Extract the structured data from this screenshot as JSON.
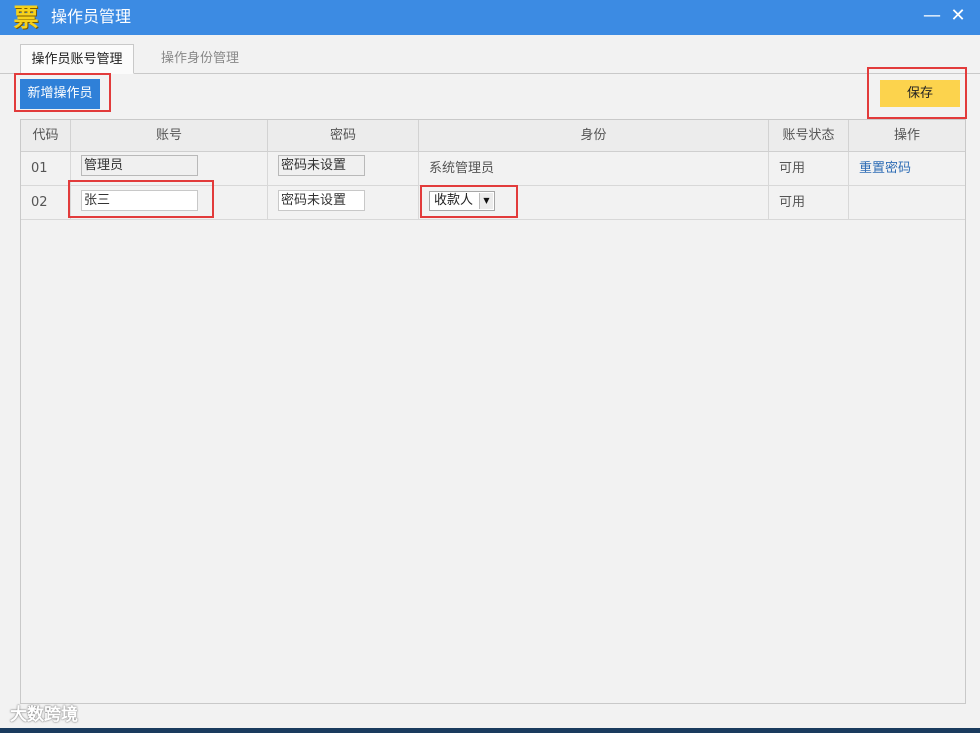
{
  "window": {
    "title": "操作员管理",
    "app_icon_char": "票",
    "minimize_glyph": "—",
    "close_glyph": "✕"
  },
  "tabs": [
    {
      "label": "操作员账号管理",
      "active": true
    },
    {
      "label": "操作身份管理",
      "active": false
    }
  ],
  "toolbar": {
    "add_label": "新增操作员",
    "save_label": "保存"
  },
  "table": {
    "headers": [
      "代码",
      "账号",
      "密码",
      "身份",
      "账号状态",
      "操作"
    ],
    "rows": [
      {
        "code": "01",
        "account": "管理员",
        "password": "密码未设置",
        "role": "系统管理员",
        "status": "可用",
        "action": "重置密码"
      },
      {
        "code": "02",
        "account": "张三",
        "password": "密码未设置",
        "role": "收款人",
        "status": "可用",
        "action": ""
      }
    ]
  },
  "watermark": "大数跨境",
  "colors": {
    "titlebar": "#3c8be3",
    "primary_button": "#2f80d8",
    "save_button": "#fcd34d",
    "highlight": "#e23b3b"
  }
}
